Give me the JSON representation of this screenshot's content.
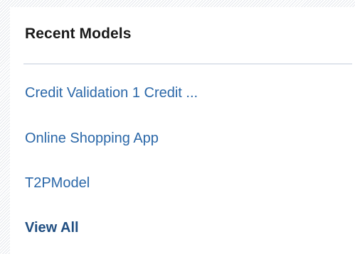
{
  "panel": {
    "title": "Recent Models",
    "models": [
      {
        "label": "Credit Validation 1 Credit ..."
      },
      {
        "label": "Online Shopping App"
      },
      {
        "label": "T2PModel"
      }
    ],
    "view_all_label": "View All"
  },
  "colors": {
    "link": "#2a67a8",
    "view_all": "#214f82",
    "title": "#1a1a1a",
    "divider": "#dfe4ec"
  }
}
